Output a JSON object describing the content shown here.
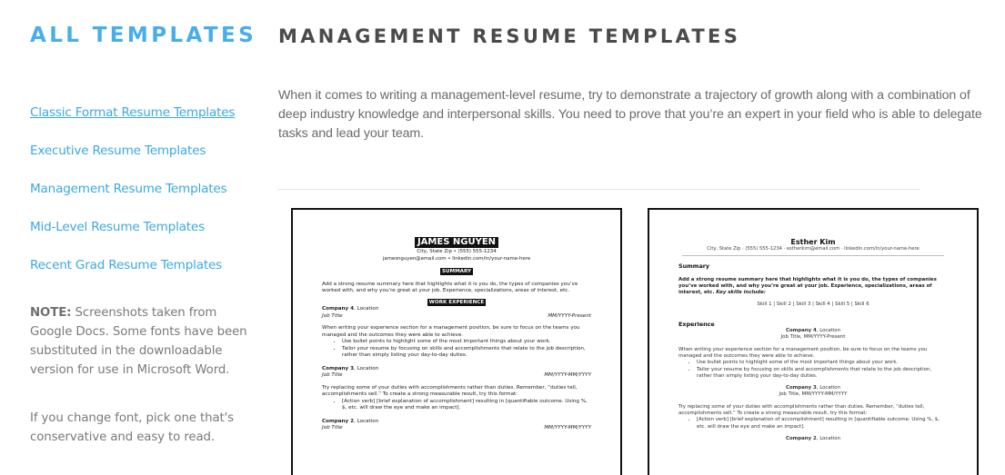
{
  "sidebar": {
    "title": "ALL TEMPLATES",
    "links": [
      {
        "label": "Classic Format Resume Templates",
        "active": true
      },
      {
        "label": "Executive Resume Templates",
        "active": false
      },
      {
        "label": "Management Resume Templates",
        "active": false
      },
      {
        "label": "Mid-Level Resume Templates",
        "active": false
      },
      {
        "label": "Recent Grad Resume Templates",
        "active": false
      }
    ],
    "note_label": "NOTE:",
    "note_text": " Screenshots taken from Google Docs. Some fonts have been substituted in the downloadable version for use in Microsoft Word.",
    "tip_text": "If you change font, pick one that's conservative and easy to read."
  },
  "main": {
    "title": "MANAGEMENT RESUME TEMPLATES",
    "intro": "When it comes to writing a management-level resume, try to demonstrate a trajectory of growth along with a combination of deep industry knowledge and interpersonal skills. You need to prove that you’re an expert in your field who is able to delegate tasks and lead your team."
  },
  "colors": {
    "accent": "#47aeea",
    "link": "#3ba8e4",
    "heading": "#4a4a4a",
    "body_text": "#6b6b6b"
  },
  "templates": [
    {
      "name": "JAMES NGUYEN",
      "contact_line1": "City, State Zip • (555) 555-1234",
      "contact_line2": "jamesnguyen@email.com • linkedin.com/in/your-name-here",
      "summary_heading": "SUMMARY",
      "summary": "Add a strong resume summary here that highlights what it is you do, the types of companies you’ve worked with, and why you’re great at your job. Experience, specializations, areas of interest, etc.",
      "experience_heading": "WORK EXPERIENCE",
      "jobs": [
        {
          "company": "Company 4",
          "location": ", Location",
          "title": "Job Title",
          "dates": "MM/YYYY-Present",
          "desc": "When writing your experience section for a management position, be sure to focus on the teams you managed and the outcomes they were able to achieve.",
          "bullets": [
            "Use bullet points to highlight some of the most important things about your work.",
            "Tailor your resume by focusing on skills and accomplishments that relate to the job description, rather than simply listing your day-to-day duties."
          ]
        },
        {
          "company": "Company 3",
          "location": ", Location",
          "title": "Job Title",
          "dates": "MM/YYYY-MM/YYYY",
          "desc": "Try replacing some of your duties with accomplishments rather than duties. Remember, “duties tell, accomplishments sell.” To create a strong measurable result, try this format:",
          "bullets": [
            "[Action verb] [brief explanation of accomplishment] resulting in [quantifiable outcome. Using %, $, etc. will draw the eye and make an impact]."
          ]
        },
        {
          "company": "Company 2",
          "location": ", Location",
          "title": "Job Title",
          "dates": "MM/YYYY-MM/YYYY"
        }
      ]
    },
    {
      "name": "Esther Kim",
      "contact": "City, State Zip · (555) 555-1234 · estherkim@email.com · linkedin.com/in/your-name-here",
      "summary_heading": "Summary",
      "summary": "Add a strong resume summary here that highlights what it is you do, the types of companies you’ve worked with, and why you’re great at your job. Experience, specializations, areas of interest, etc. ",
      "summary_key": "Key skills include:",
      "skills": "Skill 1 | Skill 2 | Skill 3 | Skill 4 | Skill 5 | Skill 6",
      "experience_heading": "Experience",
      "jobs": [
        {
          "company": "Company 4",
          "location": ", Location",
          "title_dates": "Job Title, MM/YYYY-Present",
          "desc": "When writing your experience section for a management position, be sure to focus on the teams you managed and the outcomes they were able to achieve.",
          "bullets": [
            "Use bullet points to highlight some of the most important things about your work.",
            "Tailor your resume by focusing on skills and accomplishments that relate to the job description, rather than simply listing your day-to-day duties."
          ]
        },
        {
          "company": "Company 3",
          "location": ", Location",
          "title_dates": "Job Title, MM/YYYY-MM/YYYY",
          "desc": "Try replacing some of your duties with accomplishments rather than duties. Remember, “duties tell, accomplishments sell.” To create a strong measurable result, try this format:",
          "bullets": [
            "[Action verb] [brief explanation of accomplishment] resulting in [quantifiable outcome. Using %, $, etc. will draw the eye and make an impact]."
          ]
        },
        {
          "company": "Company 2",
          "location": ", Location"
        }
      ]
    }
  ]
}
